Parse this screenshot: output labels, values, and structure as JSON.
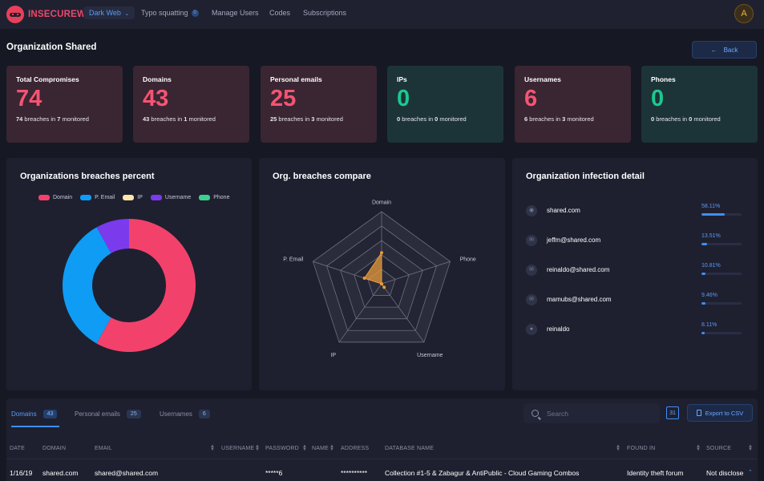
{
  "brand": {
    "name": "INSECUREWEB"
  },
  "nav": {
    "items": [
      {
        "label": "Dark Web",
        "active": true
      },
      {
        "label": "Typo squatting",
        "badge": "0"
      },
      {
        "label": "Manage Users"
      },
      {
        "label": "Codes"
      },
      {
        "label": "Subscriptions"
      }
    ],
    "avatar": "A"
  },
  "page": {
    "title": "Organization Shared",
    "back_label": "Back"
  },
  "stats": [
    {
      "label": "Total Compromises",
      "value": "74",
      "sub_prefix": "74",
      "sub_mid": " breaches in ",
      "sub_count": "7",
      "sub_suffix": " monitored",
      "tone": "red"
    },
    {
      "label": "Domains",
      "value": "43",
      "sub_prefix": "43",
      "sub_mid": " breaches in ",
      "sub_count": "1",
      "sub_suffix": " monitored",
      "tone": "red"
    },
    {
      "label": "Personal emails",
      "value": "25",
      "sub_prefix": "25",
      "sub_mid": " breaches in ",
      "sub_count": "3",
      "sub_suffix": " monitored",
      "tone": "red"
    },
    {
      "label": "IPs",
      "value": "0",
      "sub_prefix": "0",
      "sub_mid": " breaches in ",
      "sub_count": "0",
      "sub_suffix": " monitored",
      "tone": "teal"
    },
    {
      "label": "Usernames",
      "value": "6",
      "sub_prefix": "6",
      "sub_mid": " breaches in ",
      "sub_count": "3",
      "sub_suffix": " monitored",
      "tone": "red"
    },
    {
      "label": "Phones",
      "value": "0",
      "sub_prefix": "0",
      "sub_mid": " breaches in ",
      "sub_count": "0",
      "sub_suffix": " monitored",
      "tone": "teal"
    }
  ],
  "panels": {
    "percent_title": "Organizations breaches percent",
    "compare_title": "Org. breaches compare",
    "infection_title": "Organization infection detail"
  },
  "chart_data": [
    {
      "type": "pie",
      "legend_position": "top",
      "categories": [
        "Domain",
        "P. Email",
        "IP",
        "Username",
        "Phone"
      ],
      "values": [
        43,
        25,
        0,
        6,
        0
      ],
      "colors": [
        "#f2426b",
        "#0f9cf5",
        "#fbe7a8",
        "#7c3aed",
        "#3ecf8e"
      ]
    },
    {
      "type": "radar",
      "axes": [
        "Domain",
        "Phone",
        "Username",
        "IP",
        "P. Email"
      ],
      "values": [
        43,
        0,
        6,
        0,
        25
      ],
      "max": 100,
      "color": "#e89a3c"
    }
  ],
  "infection": [
    {
      "label": "shared.com",
      "pct": "58.11%",
      "fraction": 0.5811,
      "icon": "globe-icon"
    },
    {
      "label": "jeffm@shared.com",
      "pct": "13.51%",
      "fraction": 0.1351,
      "icon": "mail-icon"
    },
    {
      "label": "reinaldo@shared.com",
      "pct": "10.81%",
      "fraction": 0.1081,
      "icon": "mail-icon"
    },
    {
      "label": "mamubs@shared.com",
      "pct": "9.46%",
      "fraction": 0.0946,
      "icon": "mail-icon"
    },
    {
      "label": "reinaldo",
      "pct": "8.11%",
      "fraction": 0.0811,
      "icon": "user-icon"
    }
  ],
  "table": {
    "tabs": [
      {
        "label": "Domains",
        "count": "43",
        "active": true
      },
      {
        "label": "Personal emails",
        "count": "25"
      },
      {
        "label": "Usernames",
        "count": "6"
      }
    ],
    "search_placeholder": "Search",
    "calendar_day": "31",
    "export_label": "Export to CSV",
    "columns": [
      "DATE",
      "DOMAIN",
      "EMAIL",
      "USERNAME",
      "PASSWORD",
      "NAME",
      "ADDRESS",
      "DATABASE NAME",
      "FOUND IN",
      "SOURCE"
    ],
    "rows": [
      [
        "1/16/19",
        "shared.com",
        "shared@shared.com",
        "",
        "*****6",
        "",
        "**********",
        "Collection #1-5 & Zabagur & AntiPublic - Cloud Gaming Combos",
        "Identity theft forum",
        "Not disclose"
      ]
    ]
  }
}
